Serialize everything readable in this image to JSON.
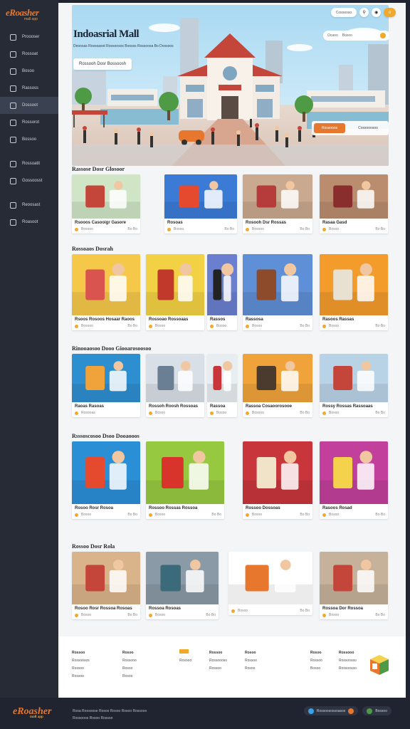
{
  "brand": {
    "logo_text": "eRoasher",
    "logo_sub": "mall app"
  },
  "sidebar": {
    "items": [
      {
        "label": "Proooser"
      },
      {
        "label": "Rossoat"
      },
      {
        "label": "Bosoo"
      },
      {
        "label": "Rassoss"
      },
      {
        "label": "Dossoot",
        "active": true
      },
      {
        "label": "Rossorot"
      },
      {
        "label": "Bossoo"
      },
      {
        "label": "Rossoatit"
      },
      {
        "label": "Gossoosst"
      },
      {
        "label": "Reoosast"
      },
      {
        "label": "Roasoot"
      }
    ]
  },
  "topbar": {
    "left_pill": "Cosoooso",
    "right_badge": "0"
  },
  "hero": {
    "title": "Indoasrial Mall",
    "subtitle": "Deoosas Rossoasot Rossoosos Boosss Rossoosa Bo Dossoos",
    "cta": "Rossooh Dosr Bossoosh",
    "search_placeholder": "Ocaoo",
    "search_tag": "Bosoo",
    "action_primary": "Rossooos",
    "action_secondary": "Cossooosoo"
  },
  "sections": [
    {
      "title": "Rassose Dosr Glosoor",
      "cards": [
        {
          "title": "Rsooos Casooigr Gasore",
          "meta": "Bosooo",
          "right": "Bo Bo"
        },
        {
          "title": "Rosoas",
          "meta": "Bosoo",
          "right": "Bo Bo"
        },
        {
          "title": "Rosooh Dsr Rossas",
          "meta": "Bosooo",
          "right": "Bo Bo"
        },
        {
          "title": "Rasaa Gasd",
          "meta": "Bosoo",
          "right": "Bo Bo"
        }
      ]
    },
    {
      "title": "Rossoaos Dosrah",
      "cards": [
        {
          "title": "Rsoos Rosoos Hosaar Raoos",
          "meta": "Bosooo",
          "right": "Bo Bo"
        },
        {
          "title": "Rossoao Rossoaas",
          "meta": "Bosoo",
          "right": ""
        },
        {
          "title": "Rassos",
          "meta": "Bosoo",
          "right": ""
        },
        {
          "title": "Rassosa",
          "meta": "Bosoo",
          "right": "Bo Bo"
        },
        {
          "title": "Rasoos Rassas",
          "meta": "Bosoo",
          "right": "Bo Bo"
        }
      ]
    },
    {
      "title": "Rinooaosoo Dooo Giooarosoosoo",
      "cards": [
        {
          "title": "Raoas Rasoas",
          "meta": "Rosooas",
          "right": ""
        },
        {
          "title": "Rossoh Roosh Rossoas",
          "meta": "Bosoo",
          "right": ""
        },
        {
          "title": "Rassoa",
          "meta": "Bosoo",
          "right": ""
        },
        {
          "title": "Rassoa Cosaoorosooe",
          "meta": "Bosooo",
          "right": "Bo Bo"
        },
        {
          "title": "Rossy Rossas Rassoaas",
          "meta": "Bosoo",
          "right": "Bo Bo"
        }
      ]
    },
    {
      "title": "Rsssoscosoo Dsoo Dooaooos",
      "cards": [
        {
          "title": "Rosoo Rosr Rosoa",
          "meta": "Bosoo",
          "right": "Bo Bo"
        },
        {
          "title": "Rossoo Rossas Rossoa",
          "meta": "Bosoo",
          "right": "Bo Bo"
        },
        {
          "title": "Rossoo Dossoas",
          "meta": "Bosoo",
          "right": "Bo Bo"
        },
        {
          "title": "Rasoos Rosad",
          "meta": "Bosoo",
          "right": "Bo Bo"
        }
      ]
    },
    {
      "title": "Rossoo Dosr Rola",
      "cards": [
        {
          "title": "Rosoo Rosr Rossoa Rosoas",
          "meta": "Bosoo",
          "right": "Bo Bo"
        },
        {
          "title": "Rossoa Rosoas",
          "meta": "Bosoo",
          "right": "Bo Bo"
        },
        {
          "title": "",
          "meta": "Bosoo",
          "right": "Bo Bo"
        },
        {
          "title": "Rossoa Dor Rossoa",
          "meta": "Bosoo",
          "right": "Bo Bo"
        }
      ]
    }
  ],
  "footer": {
    "col1": [
      "Rossoo",
      "Rossoosos",
      "Rossoo",
      "Rossoo"
    ],
    "col2": [
      "Rosoo",
      "Rossooo",
      "Rosoo",
      "Rosoo"
    ],
    "col3": [
      "Rosooo"
    ],
    "col4": [
      "Rossoo",
      "Rossoooso",
      "Rossoo"
    ],
    "col5": [
      "Rosoo",
      "Rossoo",
      "Rosoo"
    ],
    "col6": [
      "Rosoo",
      "Rossoo",
      "Bosoo"
    ],
    "col7": [
      "Rossooo",
      "Rossoosso",
      "Rossoosso"
    ]
  },
  "bottombar": {
    "links_row1": "Rosa Roosoose  Rosoo Rosoo  Rosoo Rossooo",
    "links_row2": "Rossooos  Rosoo Rossoo",
    "pill1": "Rossoosossoasos",
    "pill2": "Bossoo"
  },
  "colors": {
    "accent": "#e8772e",
    "gold": "#f0a92b",
    "sidebar": "#262b36"
  }
}
